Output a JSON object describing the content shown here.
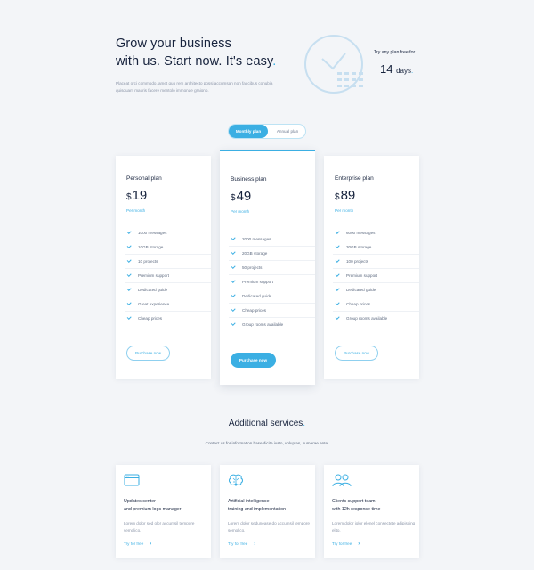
{
  "hero": {
    "title_line1": "Grow your business",
    "title_line2": "with us. Start now. It's easy",
    "title_dot": ".",
    "description": "Placeat orci commodo, amet quo rem architecto possi accumsan non faucibus conubia quisquam mauris facere mentolo immonde graiono."
  },
  "trial": {
    "label": "Try any plan free for",
    "days_number": "14",
    "days_unit": "days",
    "dot": "."
  },
  "billing_toggle": {
    "monthly": "Monthly plan",
    "annual": "Annual plan",
    "selected": "monthly"
  },
  "plans": [
    {
      "name": "Personal plan",
      "currency": "$",
      "price": "19",
      "period": "Per month",
      "features": [
        "1000 messages",
        "10GB storage",
        "10 projects",
        "Premium support",
        "Dedicated guide",
        "Great experience",
        "Cheap prices"
      ],
      "cta": "Purchase now",
      "featured": false
    },
    {
      "name": "Business plan",
      "currency": "$",
      "price": "49",
      "period": "Per month",
      "features": [
        "2000 messages",
        "20GB storage",
        "50 projects",
        "Premium support",
        "Dedicated guide",
        "Cheap prices",
        "Group rooms available"
      ],
      "cta": "Purchase now",
      "featured": true
    },
    {
      "name": "Enterprise plan",
      "currency": "$",
      "price": "89",
      "period": "Per month",
      "features": [
        "6000 messages",
        "30GB storage",
        "100 projects",
        "Premium support",
        "Dedicated guide",
        "Cheap prices",
        "Group rooms available"
      ],
      "cta": "Purchase now",
      "featured": false
    }
  ],
  "additional": {
    "title": "Additional services",
    "title_dot": ".",
    "subtitle": "Contact us for information base dicite iusto, voluptas, numerae ante."
  },
  "services": [
    {
      "icon": "browser-window-icon",
      "title_line1": "Updates center",
      "title_line2": "and premium logs manager",
      "description": "Lorem dolor sed olor accumsil tempore semolico.",
      "link": "Try for free"
    },
    {
      "icon": "brain-icon",
      "title_line1": "Artificial intelligence",
      "title_line2": "training and implementation",
      "description": "Lorem dolor sedunease do accumsil tempore semolico.",
      "link": "Try for free"
    },
    {
      "icon": "users-icon",
      "title_line1": "Clients support team",
      "title_line2": "with 12h response time",
      "description": "Lorem dolor iolor elenel consectete adipiscing elito.",
      "link": "Try for free"
    }
  ],
  "colors": {
    "accent": "#3bafe3",
    "heading": "#17233d",
    "background": "#f3f5f8"
  }
}
